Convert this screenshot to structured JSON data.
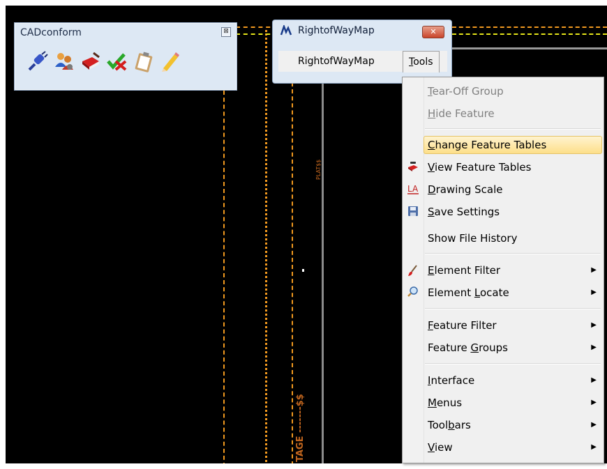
{
  "cadconform": {
    "title": "CADconform",
    "close_glyph": "⊠",
    "tools": [
      {
        "name": "connect-plug-icon"
      },
      {
        "name": "users-settings-icon"
      },
      {
        "name": "red-book-edit-icon"
      },
      {
        "name": "check-cross-icon"
      },
      {
        "name": "clipboard-icon"
      },
      {
        "name": "pencil-icon"
      }
    ]
  },
  "row_window": {
    "title": "RightofWayMap",
    "close_glyph": "✕",
    "menubar": {
      "app_label": "RightofWayMap",
      "tools_label": "Tools",
      "tools_underline": "T",
      "tools_rest": "ools"
    }
  },
  "tools_menu": {
    "items": [
      {
        "u": "T",
        "rest": "ear-Off Group",
        "disabled": true
      },
      {
        "u": "H",
        "rest": "ide Feature",
        "disabled": true
      },
      {
        "u": "C",
        "rest": "hange Feature Tables",
        "highlighted": true
      },
      {
        "u": "V",
        "rest": "iew Feature Tables",
        "icon": "book-view-icon"
      },
      {
        "u": "D",
        "rest": "rawing Scale",
        "icon": "scale-icon"
      },
      {
        "u": "S",
        "rest": "ave Settings",
        "icon": "floppy-disk-icon"
      },
      {
        "label": "Show File History"
      },
      {
        "u": "E",
        "rest": "lement Filter",
        "icon": "brush-filter-icon",
        "submenu": true
      },
      {
        "pre": "Element ",
        "u": "L",
        "rest": "ocate",
        "icon": "magnifier-locate-icon",
        "submenu": true
      },
      {
        "u": "F",
        "rest": "eature Filter",
        "submenu": true
      },
      {
        "pre": "Feature ",
        "u": "G",
        "rest": "roups",
        "submenu": true
      },
      {
        "u": "I",
        "rest": "nterface",
        "submenu": true
      },
      {
        "u": "M",
        "rest": "enus",
        "submenu": true
      },
      {
        "pre": "Tool",
        "u": "b",
        "rest": "ars",
        "submenu": true
      },
      {
        "u": "V",
        "rest": "iew",
        "submenu": true
      }
    ],
    "submenu_arrow": "▶"
  },
  "drawing": {
    "background": "#000000",
    "text_vertical_1": "PLAT$$",
    "text_vertical_2": "TAGE -------$$"
  },
  "colors": {
    "orange_line": "#f39a1f",
    "yellow_line": "#e6e61a",
    "highlight_fill": "#fde28f"
  }
}
